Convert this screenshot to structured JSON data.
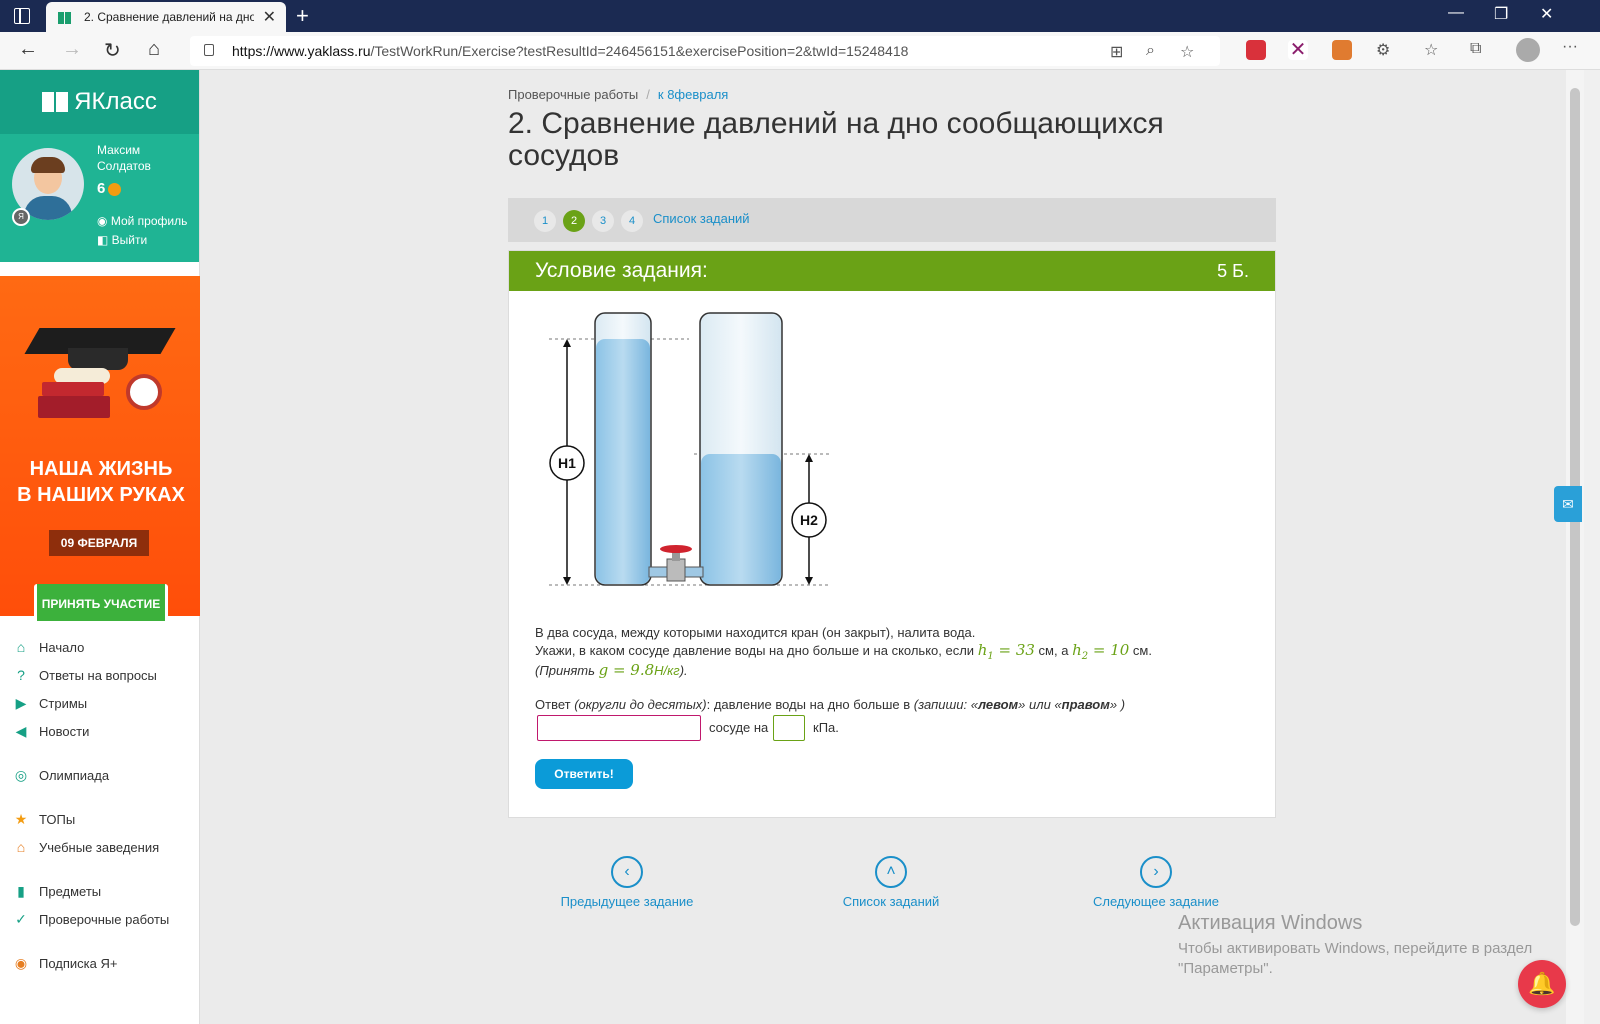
{
  "browser": {
    "tab_title": "2. Сравнение давлений на дно",
    "url_host": "https://www.yaklass.ru",
    "url_path": "/TestWorkRun/Exercise?testResultId=246456151&exercisePosition=2&twId=15248418"
  },
  "sidebar": {
    "brand": "ЯКласс",
    "user_first": "Максим",
    "user_last": "Солдатов",
    "score": "6",
    "profile_link": "Мой профиль",
    "logout_link": "Выйти",
    "ad": {
      "headline1": "НАША ЖИЗНЬ",
      "headline2": "В НАШИХ РУКАХ",
      "date": "09 ФЕВРАЛЯ",
      "button": "ПРИНЯТЬ УЧАСТИЕ"
    },
    "menu": [
      {
        "label": "Начало",
        "icon": "home-icon"
      },
      {
        "label": "Ответы на вопросы",
        "icon": "question-icon"
      },
      {
        "label": "Стримы",
        "icon": "play-icon"
      },
      {
        "label": "Новости",
        "icon": "megaphone-icon"
      },
      {
        "label": "Олимпиада",
        "icon": "medal-icon"
      },
      {
        "label": "ТОПы",
        "icon": "star-icon"
      },
      {
        "label": "Учебные заведения",
        "icon": "school-icon"
      },
      {
        "label": "Предметы",
        "icon": "books-icon"
      },
      {
        "label": "Проверочные работы",
        "icon": "check-icon"
      },
      {
        "label": "Подписка Я+",
        "icon": "subscription-icon"
      }
    ]
  },
  "breadcrumb": {
    "root": "Проверочные работы",
    "current": "к 8февраля"
  },
  "page_title": "2. Сравнение давлений на дно сообщающихся сосудов",
  "pager": {
    "pages": [
      "1",
      "2",
      "3",
      "4"
    ],
    "active": "2",
    "list_link": "Список заданий"
  },
  "task": {
    "header": "Условие задания:",
    "points": "5 Б.",
    "figure_labels": {
      "h1": "H1",
      "h2": "H2"
    },
    "line1": "В два сосуда, между которыми находится кран (он закрыт), налита вода.",
    "line2_a": "Укажи, в каком сосуде давление воды на дно больше и на сколько, если ",
    "h1_sym": "h",
    "h1_sub": "1",
    "h1_val": " = 33",
    "line2_b": " см, а ",
    "h2_sym": "h",
    "h2_sub": "2",
    "h2_val": " = 10",
    "line2_c": " см.",
    "note_a": "(Принять ",
    "g_expr": "g = 9.8",
    "g_unit": "Н/кг",
    "note_b": ").",
    "answer_prefix": "Ответ ",
    "answer_round": "(округли до десятых)",
    "answer_mid": ": давление воды на дно больше в ",
    "answer_hint_a": "(запиши: «",
    "answer_hint_left": "левом",
    "answer_hint_or": "» или «",
    "answer_hint_right": "правом",
    "answer_hint_b": "» )",
    "vessel_label": "сосуде на",
    "unit_label": "кПа.",
    "submit": "Ответить!"
  },
  "bottom_nav": {
    "prev": "Предыдущее задание",
    "list": "Список заданий",
    "next": "Следующее задание"
  },
  "activation": {
    "title": "Активация Windows",
    "line1": "Чтобы активировать Windows, перейдите в раздел",
    "line2": "\"Параметры\"."
  }
}
